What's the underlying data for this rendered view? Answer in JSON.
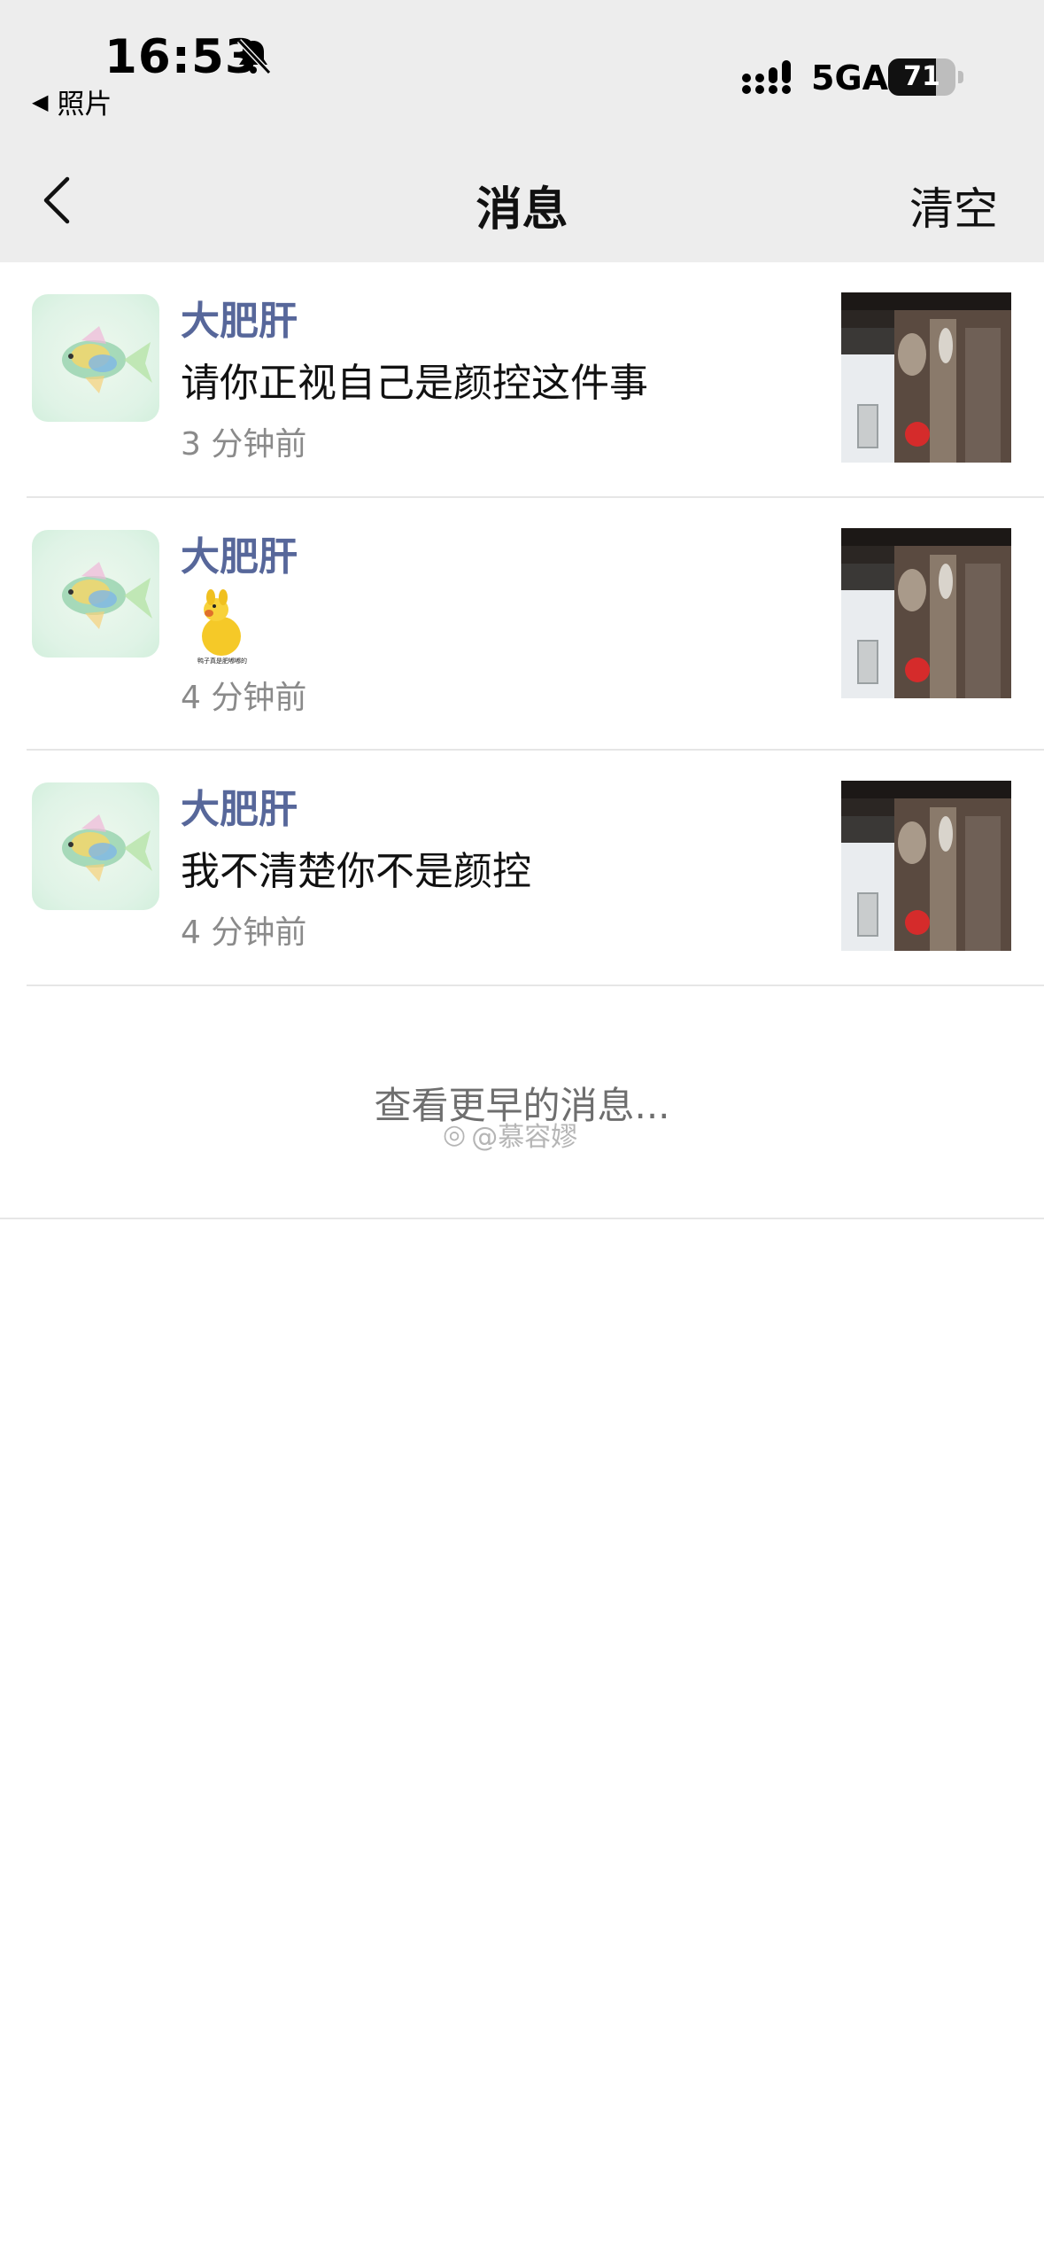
{
  "status_bar": {
    "time": "16:53",
    "back_app": "照片",
    "network": "5GA",
    "battery": "71",
    "battery_level": 0.71
  },
  "nav": {
    "title": "消息",
    "clear": "清空"
  },
  "messages": [
    {
      "name": "大肥肝",
      "text": "请你正视自己是颜控这件事",
      "time": "3 分钟前"
    },
    {
      "name": "大肥肝",
      "sticker_caption": "鸭子真是肥嘟嘟的",
      "time": "4 分钟前"
    },
    {
      "name": "大肥肝",
      "text": "我不清楚你不是颜控",
      "time": "4 分钟前"
    }
  ],
  "more": {
    "label": "查看更早的消息..."
  },
  "watermark": "@慕容嫪",
  "colors": {
    "name": "#57679a",
    "topbar": "#ededed"
  }
}
